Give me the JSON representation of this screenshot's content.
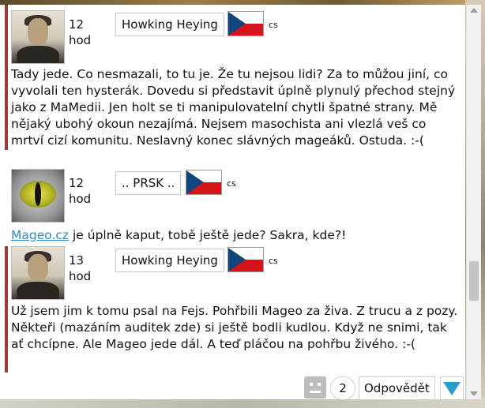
{
  "posts": [
    {
      "time": "12 hod",
      "nick": "Howking Heying",
      "lang": "cs",
      "avatar": "person-photo",
      "text": "Tady jede. Co nesmazali, to tu je. Že tu nejsou lidi? Za to můžou jiní, co vyvolali ten hysterák. Dovedu si představit úplně plynulý přechod stejný jako z MaMedii. Jen holt se ti manipulovatelní chytli špatné strany. Mě nějaký ubohý okoun nezajímá. Nejsem masochista ani vlezlá veš co mrtví cizí komunitu. Neslavný konec slávných mageáků. Ostuda. :-("
    },
    {
      "time": "12 hod",
      "nick": ".. PRSK ..",
      "lang": "cs",
      "avatar": "cat-eye",
      "link": "Mageo.cz",
      "text": " je úplně kaput, tobě ještě jede? Sakra, kde?!"
    },
    {
      "time": "13 hod",
      "nick": "Howking Heying",
      "lang": "cs",
      "avatar": "person-photo",
      "text": "Už jsem jim k tomu psal na Fejs. Pohřbili Mageo za živa. Z trucu a z pozy. Někteři (mazáním auditek zde) si ještě bodli kudlou. Když ne snimi, tak ať chcípne. Ale Mageo jede dál. A teď pláčou na pohřbu živého. :-("
    }
  ],
  "footer": {
    "count": "2",
    "reply_label": "Odpovědět",
    "icons": [
      "robot-icon",
      "arrow-down-icon"
    ]
  },
  "colors": {
    "quote_bar": "#9d3c3c",
    "link": "#2b8bbf",
    "arrow": "#2a9ad0"
  }
}
